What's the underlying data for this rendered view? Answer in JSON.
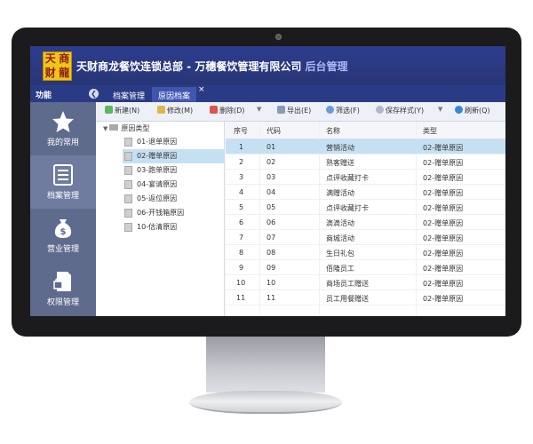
{
  "header": {
    "logo_chars": [
      "天",
      "商",
      "财",
      "龍"
    ],
    "title_main": "天财商龙餐饮连锁总部 - 万穗餐饮管理有限公司",
    "title_sub": "后台管理"
  },
  "tabbar": {
    "func_label": "功能",
    "tabs": [
      {
        "label": "档案管理"
      },
      {
        "label": "原因档案"
      }
    ],
    "close_glyph": "×"
  },
  "sidebar": {
    "items": [
      {
        "label": "我的常用",
        "icon": "star-icon"
      },
      {
        "label": "档案管理",
        "icon": "archive-icon"
      },
      {
        "label": "营业管理",
        "icon": "money-bag-icon"
      },
      {
        "label": "权限管理",
        "icon": "lock-document-icon"
      }
    ]
  },
  "toolbar": {
    "new": "新建(N)",
    "edit": "修改(M)",
    "delete": "删除(D)",
    "export": "导出(E)",
    "filter": "筛选(F)",
    "save_style": "保存样式(Y)",
    "refresh": "刷新(Q)"
  },
  "tree": {
    "root": "原因类型",
    "nodes": [
      {
        "label": "01-退单原因"
      },
      {
        "label": "02-赠单原因"
      },
      {
        "label": "03-跑单原因"
      },
      {
        "label": "04-宴请原因"
      },
      {
        "label": "05-返位原因"
      },
      {
        "label": "06-开钱箱原因"
      },
      {
        "label": "10-估清原因"
      }
    ]
  },
  "grid": {
    "columns": [
      "序号",
      "代码",
      "名称",
      "类型"
    ],
    "rows": [
      {
        "no": "1",
        "code": "01",
        "name": "营销活动",
        "type": "02-赠单原因"
      },
      {
        "no": "2",
        "code": "02",
        "name": "熟客赠送",
        "type": "02-赠单原因"
      },
      {
        "no": "3",
        "code": "03",
        "name": "点评收藏打卡",
        "type": "02-赠单原因"
      },
      {
        "no": "4",
        "code": "04",
        "name": "满赠活动",
        "type": "02-赠单原因"
      },
      {
        "no": "5",
        "code": "05",
        "name": "点评收藏打卡",
        "type": "02-赠单原因"
      },
      {
        "no": "6",
        "code": "06",
        "name": "滴滴活动",
        "type": "02-赠单原因"
      },
      {
        "no": "7",
        "code": "07",
        "name": "商城活动",
        "type": "02-赠单原因"
      },
      {
        "no": "8",
        "code": "08",
        "name": "生日礼包",
        "type": "02-赠单原因"
      },
      {
        "no": "9",
        "code": "09",
        "name": "佰隆员工",
        "type": "02-赠单原因"
      },
      {
        "no": "10",
        "code": "10",
        "name": "商场员工赠送",
        "type": "02-赠单原因"
      },
      {
        "no": "11",
        "code": "11",
        "name": "员工用餐赠送",
        "type": "02-赠单原因"
      }
    ]
  }
}
